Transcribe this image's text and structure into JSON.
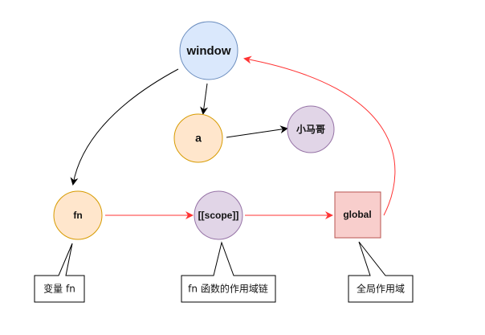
{
  "nodes": {
    "window": {
      "label": "window",
      "fill": "#dae8fc",
      "stroke": "#6c8ebf"
    },
    "a": {
      "label": "a",
      "fill": "#ffe6cc",
      "stroke": "#d79b00"
    },
    "xiaomage": {
      "label": "小马哥",
      "fill": "#e1d5e7",
      "stroke": "#9673a6"
    },
    "fn": {
      "label": "fn",
      "fill": "#ffe6cc",
      "stroke": "#d79b00"
    },
    "scope": {
      "label": "[[scope]]",
      "fill": "#e1d5e7",
      "stroke": "#9673a6"
    },
    "global": {
      "label": "global",
      "fill": "#f8cecc",
      "stroke": "#b85450"
    }
  },
  "callouts": {
    "variable_fn": "变量 fn",
    "fn_scope_chain": "fn 函数的作用域链",
    "global_scope": "全局作用域"
  },
  "edge_colors": {
    "black": "#000000",
    "red": "#ff3333"
  }
}
